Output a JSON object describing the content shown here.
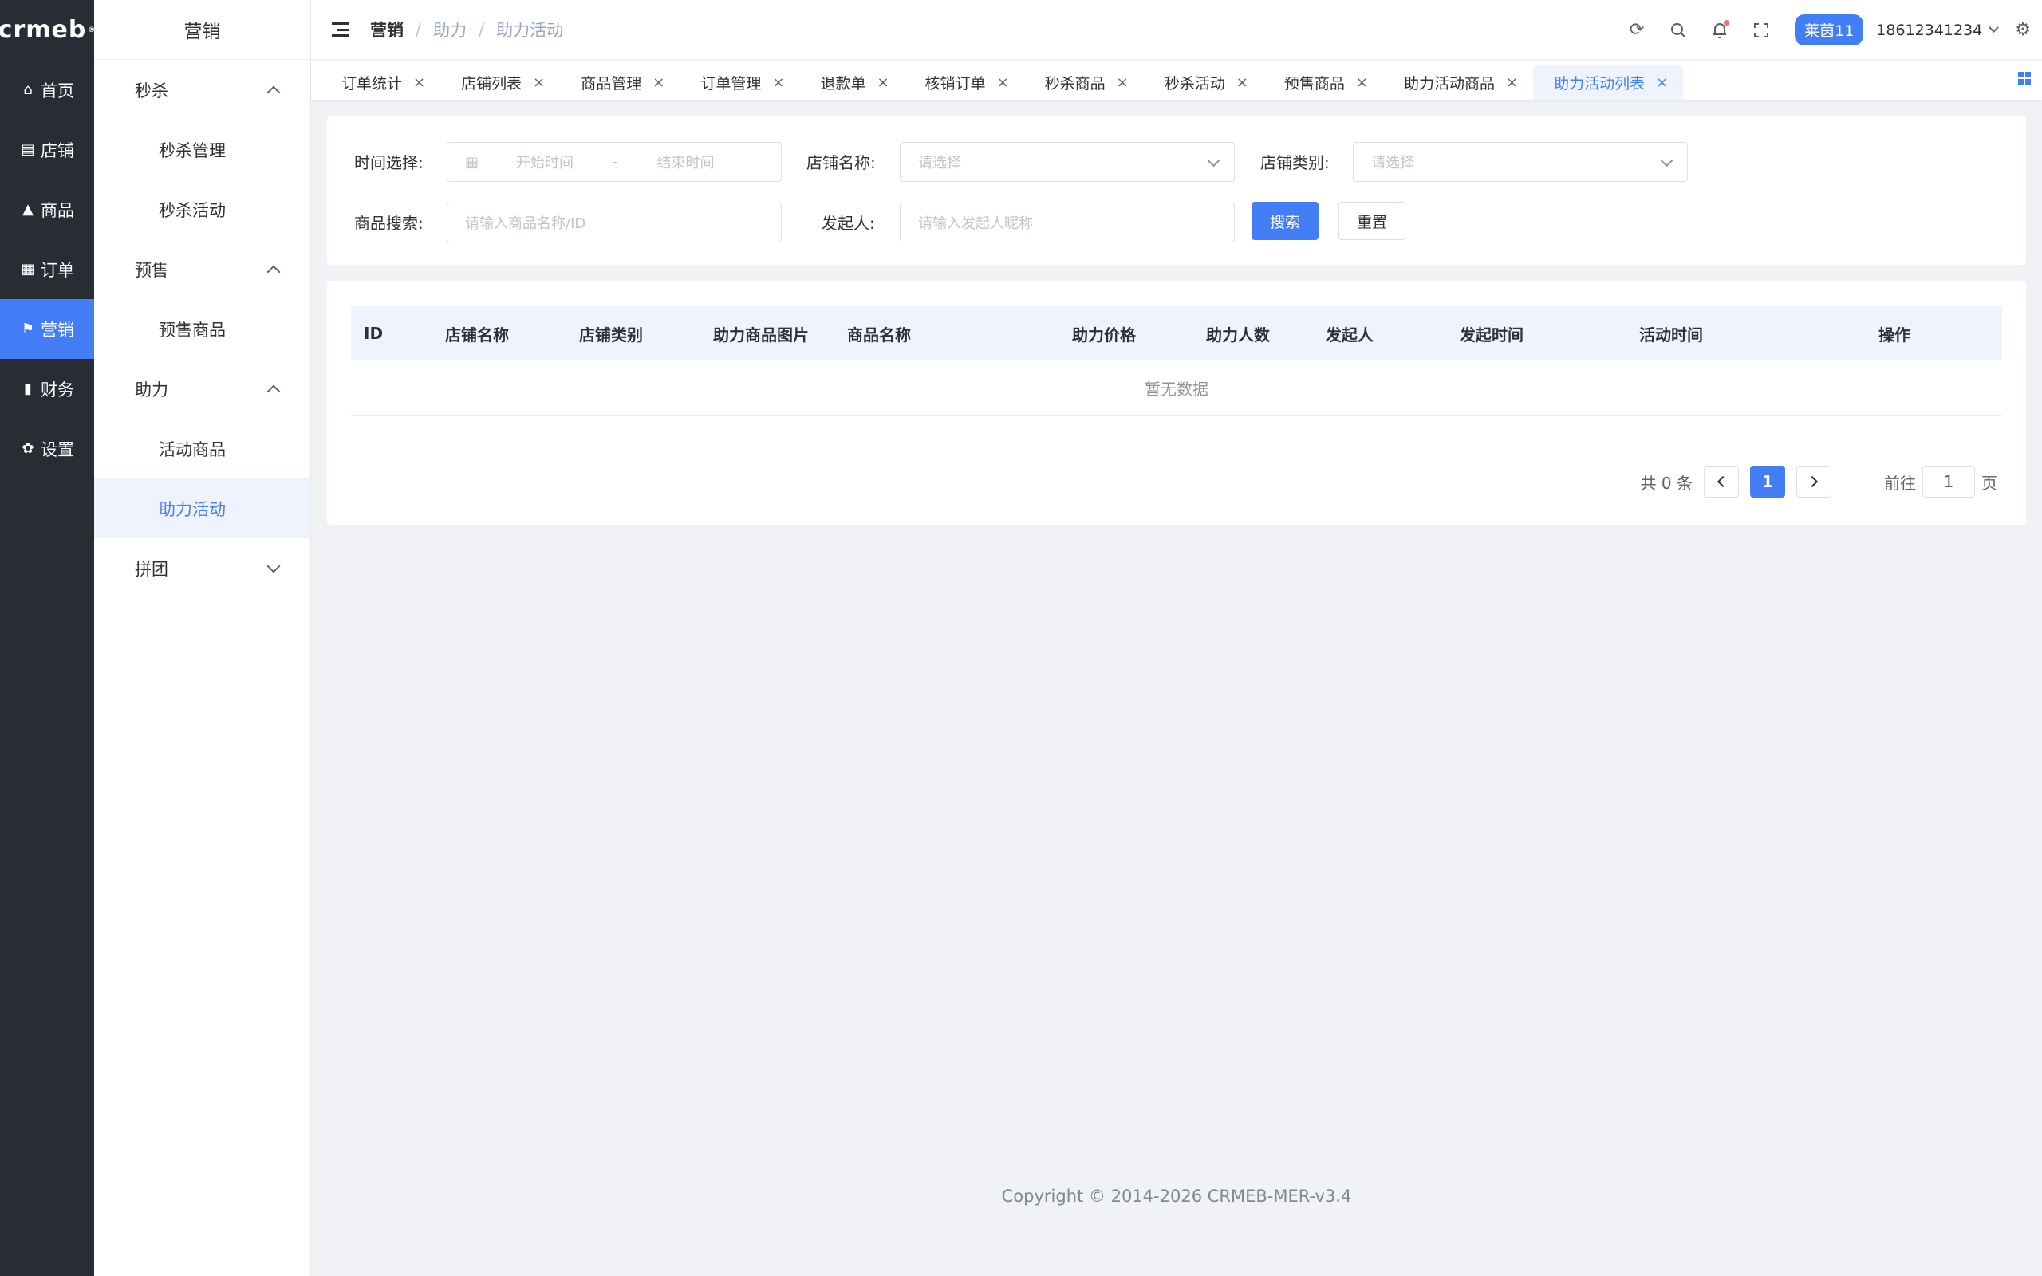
{
  "brand": {
    "logo_text": "crmeb",
    "logo_mark": "®"
  },
  "rail": [
    {
      "label": "首页",
      "icon": "⌂"
    },
    {
      "label": "店铺",
      "icon": "▤"
    },
    {
      "label": "商品",
      "icon": "▲"
    },
    {
      "label": "订单",
      "icon": "▦"
    },
    {
      "label": "营销",
      "icon": "⚑"
    },
    {
      "label": "财务",
      "icon": "▮"
    },
    {
      "label": "设置",
      "icon": "✿"
    }
  ],
  "submenu": {
    "title": "营销",
    "groups": [
      {
        "label": "秒杀",
        "items": [
          "秒杀管理",
          "秒杀活动"
        ]
      },
      {
        "label": "预售",
        "items": [
          "预售商品"
        ]
      },
      {
        "label": "助力",
        "items": [
          "活动商品",
          "助力活动"
        ]
      },
      {
        "label": "拼团",
        "items": []
      }
    ]
  },
  "header": {
    "breadcrumb": [
      "营销",
      "助力",
      "助力活动"
    ],
    "breadcrumb_sep": "/",
    "user_badge": "莱茵11",
    "user_phone": "18612341234"
  },
  "tabs": [
    "订单统计",
    "店铺列表",
    "商品管理",
    "订单管理",
    "退款单",
    "核销订单",
    "秒杀商品",
    "秒杀活动",
    "预售商品",
    "助力活动商品",
    "助力活动列表"
  ],
  "tab_close": "×",
  "filters": {
    "time_label": "时间选择:",
    "start_placeholder": "开始时间",
    "range_sep": "-",
    "end_placeholder": "结束时间",
    "store_name_label": "店铺名称:",
    "store_name_placeholder": "请选择",
    "store_type_label": "店铺类别:",
    "store_type_placeholder": "请选择",
    "product_label": "商品搜索:",
    "product_placeholder": "请输入商品名称/ID",
    "initiator_label": "发起人:",
    "initiator_placeholder": "请输入发起人昵称",
    "search_button": "搜索",
    "reset_button": "重置"
  },
  "table": {
    "columns": [
      "ID",
      "店铺名称",
      "店铺类别",
      "助力商品图片",
      "商品名称",
      "助力价格",
      "助力人数",
      "发起人",
      "发起时间",
      "活动时间",
      "操作"
    ],
    "empty_text": "暂无数据"
  },
  "pagination": {
    "total_text": "共 0 条",
    "current_page": "1",
    "goto_label": "前往",
    "goto_value": "1",
    "page_suffix": "页"
  },
  "footer": "Copyright © 2014-2026 CRMEB-MER-v3.4",
  "colors": {
    "accent": "#437ef7",
    "rail_bg": "#282c34",
    "page_bg": "#f0f2f5"
  }
}
